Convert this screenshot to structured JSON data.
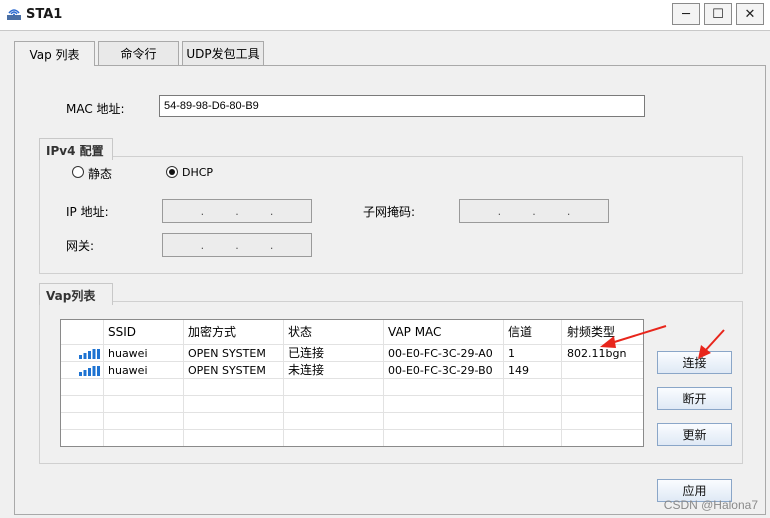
{
  "window": {
    "title": "STA1",
    "minimize": "─",
    "maximize": "☐",
    "close": "✕"
  },
  "tabs": [
    {
      "label": "Vap 列表"
    },
    {
      "label": "命令行"
    },
    {
      "label": "UDP发包工具"
    }
  ],
  "mac": {
    "label": "MAC 地址:",
    "value": "54-89-98-D6-80-B9"
  },
  "ipv4": {
    "group_label": "IPv4 配置",
    "static_label": "静态",
    "dhcp_label": "DHCP",
    "selected": "DHCP",
    "ip_label": "IP 地址:",
    "mask_label": "子网掩码:",
    "gateway_label": "网关:",
    "ip_dots": ".",
    "ip_value": "",
    "mask_value": "",
    "gateway_value": ""
  },
  "vap": {
    "group_label": "Vap列表",
    "columns": [
      "SSID",
      "加密方式",
      "状态",
      "VAP MAC",
      "信道",
      "射频类型"
    ],
    "rows": [
      {
        "ssid": "huawei",
        "encryption": "OPEN SYSTEM",
        "status": "已连接",
        "vap_mac": "00-E0-FC-3C-29-A0",
        "channel": "1",
        "radio": "802.11bgn"
      },
      {
        "ssid": "huawei",
        "encryption": "OPEN SYSTEM",
        "status": "未连接",
        "vap_mac": "00-E0-FC-3C-29-B0",
        "channel": "149",
        "radio": ""
      }
    ],
    "connect_button": "连接",
    "disconnect_button": "断开",
    "refresh_button": "更新"
  },
  "apply_button": "应用",
  "watermark": "CSDN @Halona7",
  "colors": {
    "signal_blue": "#1e73d2",
    "arrow_red": "#e8261c",
    "button_border": "#8aa6c8"
  }
}
